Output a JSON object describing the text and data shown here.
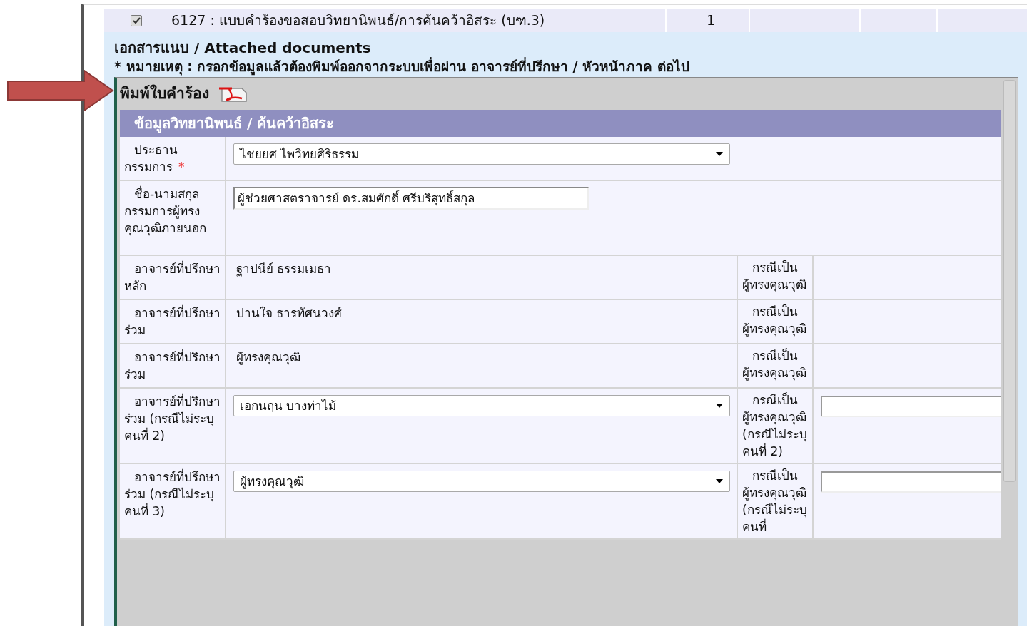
{
  "document_row": {
    "checked": true,
    "title": "6127 : แบบคำร้องขอสอบวิทยานิพนธ์/การค้นคว้าอิสระ (บฑ.3)",
    "count": "1"
  },
  "attachments": {
    "heading": "เอกสารแนบ / Attached documents",
    "note": "* หมายเหตุ : กรอกข้อมูลแล้วต้องพิมพ์ออกจากระบบเพื่อผ่าน อาจารย์ที่ปรึกษา / หัวหน้าภาค ต่อไป"
  },
  "print_panel": {
    "title": "พิมพ์ใบคำร้อง",
    "section_title": "ข้อมูลวิทยานิพนธ์ / ค้นคว้าอิสระ",
    "rows": [
      {
        "label": "ประธานกรรมการ",
        "required_mark": "*",
        "kind": "select",
        "value": "ไชยยศ ไพวิทยศิริธรรม"
      },
      {
        "label": "ชื่อ-นามสกุล กรรมการผู้ทรงคุณวุฒิภายนอก",
        "kind": "input",
        "value": "ผู้ช่วยศาสตราจารย์ ดร.สมศักดิ์ ศรีบริสุทธิ์สกุล"
      },
      {
        "label": "อาจารย์ที่ปรึกษาหลัก",
        "kind": "text",
        "value": "ฐาปนีย์ ธรรมเมธา",
        "case_label": "กรณีเป็นผู้ทรงคุณวุฒิ",
        "case_field": false
      },
      {
        "label": "อาจารย์ที่ปรึกษาร่วม",
        "kind": "text",
        "value": "ปานใจ ธารทัศนวงศ์",
        "case_label": "กรณีเป็นผู้ทรงคุณวุฒิ",
        "case_field": false
      },
      {
        "label": "อาจารย์ที่ปรึกษาร่วม",
        "kind": "text",
        "value": "ผู้ทรงคุณวุฒิ",
        "case_label": "กรณีเป็นผู้ทรงคุณวุฒิ",
        "case_field": false
      },
      {
        "label": "อาจารย์ที่ปรึกษาร่วม (กรณีไม่ระบุคนที่ 2)",
        "kind": "select",
        "value": "เอกนฤน บางท่าไม้",
        "case_label": "กรณีเป็นผู้ทรงคุณวุฒิ (กรณีไม่ระบุคนที่ 2)",
        "case_field": true
      },
      {
        "label": "อาจารย์ที่ปรึกษาร่วม (กรณีไม่ระบุคนที่ 3)",
        "kind": "select",
        "value": "ผู้ทรงคุณวุฒิ",
        "case_label": "กรณีเป็นผู้ทรงคุณวุฒิ (กรณีไม่ระบุคนที่",
        "case_field": true
      }
    ]
  }
}
